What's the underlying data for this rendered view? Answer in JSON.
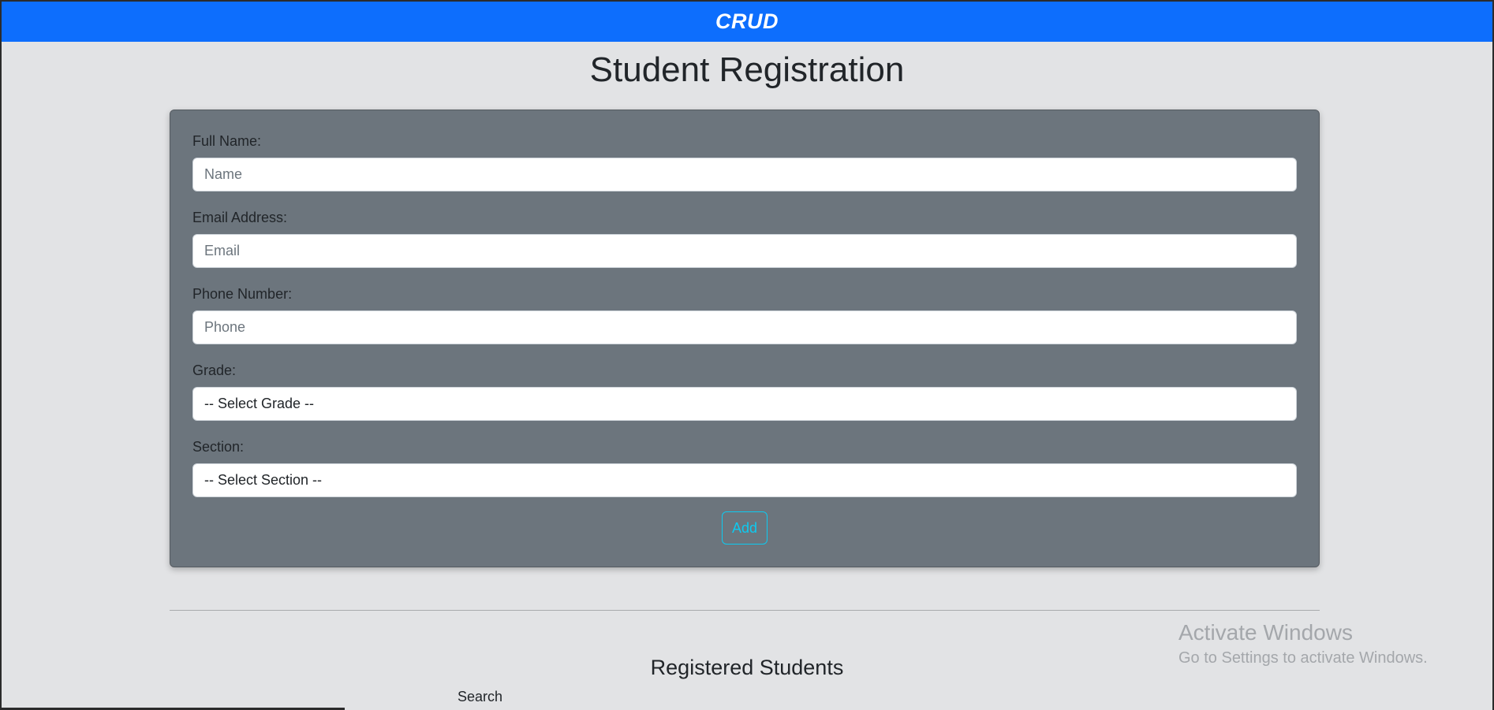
{
  "navbar": {
    "brand": "CRUD"
  },
  "page": {
    "title": "Student Registration"
  },
  "form": {
    "name": {
      "label": "Full Name:",
      "placeholder": "Name",
      "value": ""
    },
    "email": {
      "label": "Email Address:",
      "placeholder": "Email",
      "value": ""
    },
    "phone": {
      "label": "Phone Number:",
      "placeholder": "Phone",
      "value": ""
    },
    "grade": {
      "label": "Grade:",
      "selected": "-- Select Grade --"
    },
    "section": {
      "label": "Section:",
      "selected": "-- Select Section --"
    },
    "add_label": "Add"
  },
  "students": {
    "heading": "Registered Students",
    "search_label": "Search"
  },
  "watermark": {
    "title": "Activate Windows",
    "subtitle": "Go to Settings to activate Windows."
  },
  "colors": {
    "navbar": "#0d6efd",
    "card": "#6c757d",
    "background": "#e2e3e5",
    "button_outline": "#0dcaf0"
  }
}
